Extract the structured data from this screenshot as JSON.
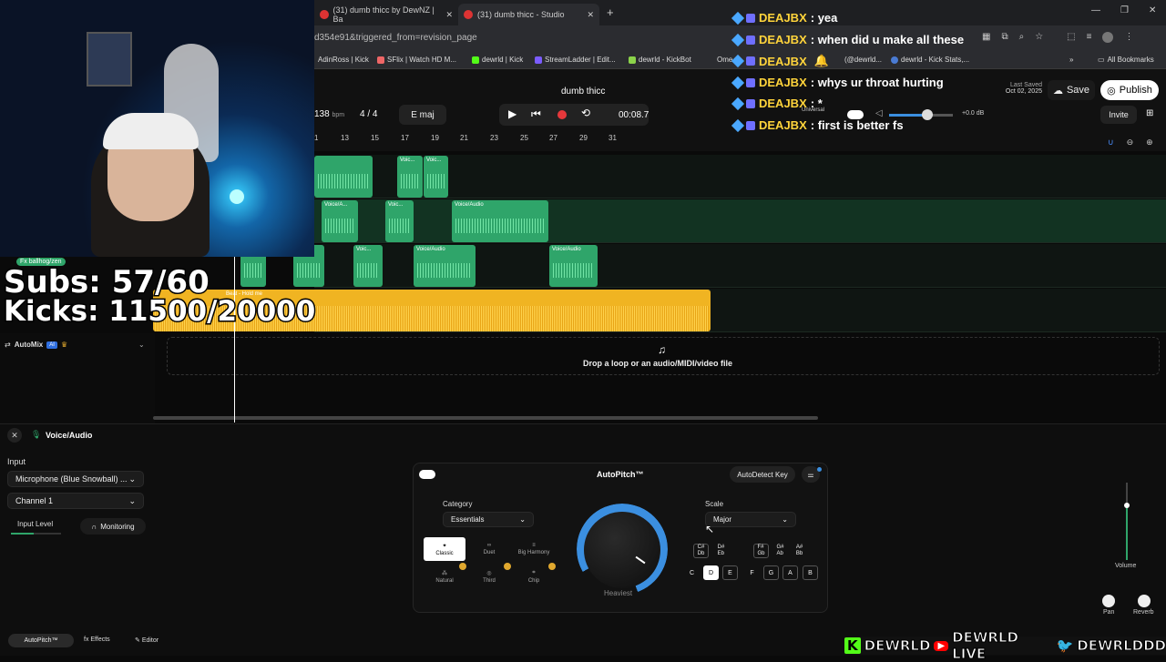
{
  "browser": {
    "tabs": [
      {
        "label": "(31) dumb thicc by DewNZ | Ba"
      },
      {
        "label": "(31) dumb thicc - Studio"
      }
    ],
    "url": "d354e91&triggered_from=revision_page",
    "bookmarks": [
      "AdinRoss | Kick",
      "SFlix | Watch HD M...",
      "dewrld | Kick",
      "StreamLadder | Edit...",
      "dewrld - KickBot",
      "Ome",
      "(@dewrld...",
      "dewrld - Kick Stats,...",
      "All Bookmarks"
    ]
  },
  "studio": {
    "project_title": "dumb thicc",
    "bpm_value": "138",
    "bpm_unit": "bpm",
    "time_signature": "4 / 4",
    "key": "E maj",
    "time": "00:08.7",
    "last_saved_label": "Last Saved",
    "last_saved_date": "Oct 02, 2025",
    "save_label": "Save",
    "publish_label": "Publish",
    "invite_label": "Invite",
    "master_gain": "+0.0 dB",
    "universal_label": "Universal",
    "ruler": [
      "1",
      "13",
      "15",
      "17",
      "19",
      "21",
      "23",
      "25",
      "27",
      "29",
      "31"
    ]
  },
  "tracks": {
    "clip_voice": "Voice/Audio",
    "clip_voice_short": "Voice/A...",
    "clip_voice_mini": "Voic...",
    "beat_clip": "Beat - Hold me"
  },
  "automix": {
    "label": "AutoMix",
    "badge": "AI"
  },
  "dropzone": {
    "text": "Drop a loop or an audio/MIDI/video file"
  },
  "panel": {
    "track_name": "Voice/Audio",
    "input_label": "Input",
    "input_device": "Microphone (Blue Snowball) ...",
    "channel": "Channel 1",
    "input_level_label": "Input Level",
    "monitoring_label": "Monitoring",
    "autopitch_title": "AutoPitch™",
    "autodetect_label": "AutoDetect Key",
    "category_label": "Category",
    "category_value": "Essentials",
    "presets": [
      "Classic",
      "Duet",
      "Big Harmony",
      "Natural",
      "Third",
      "Chip"
    ],
    "knob_label": "Heaviest",
    "scale_label": "Scale",
    "scale_value": "Major",
    "sharp_keys": [
      "C#\nDb",
      "D#\nEb",
      "F#\nGb",
      "G#\nAb",
      "A#\nBb"
    ],
    "keys": [
      "C",
      "D",
      "E",
      "F",
      "G",
      "A",
      "B"
    ],
    "volume_label": "Volume",
    "pan_label": "Pan",
    "reverb_label": "Reverb",
    "bottom_tabs": [
      "AutoPitch™",
      "Effects",
      "Editor"
    ]
  },
  "chat": [
    {
      "user": "DEAJBX",
      "msg": ": yea"
    },
    {
      "user": "DEAJBX",
      "msg": ": when did u make all these"
    },
    {
      "user": "DEAJBX",
      "msg": ""
    },
    {
      "user": "DEAJBX",
      "msg": ": whys ur throat hurting"
    },
    {
      "user": "DEAJBX",
      "msg": ": *"
    },
    {
      "user": "DEAJBX",
      "msg": ": first is better fs"
    }
  ],
  "stream": {
    "tag": "Fx ballhog/zen",
    "subs": "Subs: 57/60",
    "kicks": "Kicks: 11500/20000",
    "socials": [
      "DEWRLD",
      "DEWRLD LIVE",
      "DEWRLDDD"
    ]
  },
  "colors": {
    "accent_green": "#2fa56a",
    "beat_yellow": "#f0b422",
    "chat_name": "#ffd43b",
    "record_red": "#e5383b",
    "knob_blue": "#3b8fe0"
  }
}
